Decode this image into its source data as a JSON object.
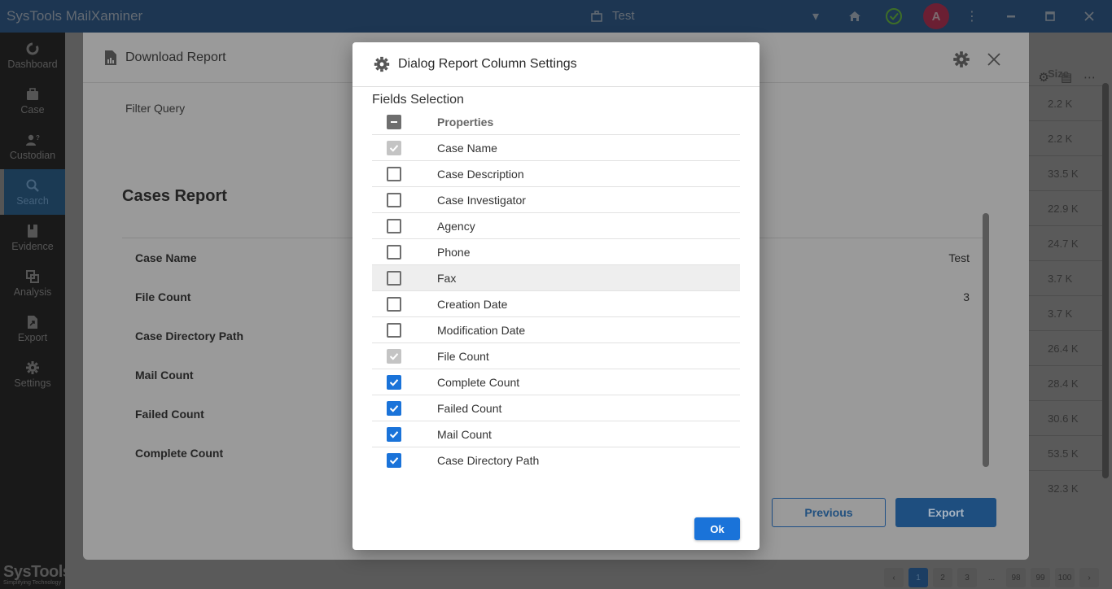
{
  "titlebar": {
    "app_title": "SysTools MailXaminer",
    "case_name": "Test",
    "avatar_letter": "A",
    "icons": [
      "briefcase-icon",
      "chevron-down-icon",
      "home-icon",
      "status-ok-icon",
      "more-vert-icon",
      "minimize-icon",
      "maximize-icon",
      "close-icon"
    ]
  },
  "sidebar": {
    "items": [
      {
        "label": "Dashboard",
        "icon": "dashboard-icon",
        "active": false
      },
      {
        "label": "Case",
        "icon": "briefcase-icon",
        "active": false
      },
      {
        "label": "Custodian",
        "icon": "custodian-icon",
        "active": false
      },
      {
        "label": "Search",
        "icon": "search-icon",
        "active": true
      },
      {
        "label": "Evidence",
        "icon": "evidence-icon",
        "active": false
      },
      {
        "label": "Analysis",
        "icon": "analysis-icon",
        "active": false
      },
      {
        "label": "Export",
        "icon": "export-icon",
        "active": false
      },
      {
        "label": "Settings",
        "icon": "gear-icon",
        "active": false
      }
    ],
    "brand": {
      "name": "SysTools",
      "tagline": "Simplifying Technology"
    }
  },
  "background_table": {
    "size_header": "Size",
    "sizes": [
      "2.2 K",
      "2.2 K",
      "33.5 K",
      "22.9 K",
      "24.7 K",
      "3.7 K",
      "3.7 K",
      "26.4 K",
      "28.4 K",
      "30.6 K",
      "53.5 K",
      "32.3 K"
    ],
    "pagination": {
      "prev": "‹",
      "pages": [
        "1",
        "2",
        "3",
        "...",
        "98",
        "99",
        "100"
      ],
      "current": "1",
      "next": "›"
    }
  },
  "download_report": {
    "title": "Download Report",
    "filter_query_label": "Filter Query",
    "report_title": "Cases Report",
    "rows": [
      {
        "key": "Case Name",
        "value": "Test"
      },
      {
        "key": "File Count",
        "value": "3"
      },
      {
        "key": "Case Directory Path",
        "value": ""
      },
      {
        "key": "Mail Count",
        "value": ""
      },
      {
        "key": "Failed Count",
        "value": ""
      },
      {
        "key": "Complete Count",
        "value": ""
      }
    ],
    "previous_label": "Previous",
    "export_label": "Export"
  },
  "column_settings": {
    "title": "Dialog Report Column Settings",
    "subtitle": "Fields Selection",
    "header_label": "Properties",
    "header_state": "indeterminate",
    "fields": [
      {
        "label": "Case Name",
        "state": "checked-disabled"
      },
      {
        "label": "Case Description",
        "state": "unchecked"
      },
      {
        "label": "Case Investigator",
        "state": "unchecked"
      },
      {
        "label": "Agency",
        "state": "unchecked"
      },
      {
        "label": "Phone",
        "state": "unchecked"
      },
      {
        "label": "Fax",
        "state": "unchecked",
        "hovered": true
      },
      {
        "label": "Creation Date",
        "state": "unchecked"
      },
      {
        "label": "Modification Date",
        "state": "unchecked"
      },
      {
        "label": "File Count",
        "state": "checked-disabled"
      },
      {
        "label": "Complete Count",
        "state": "checked"
      },
      {
        "label": "Failed Count",
        "state": "checked"
      },
      {
        "label": "Mail Count",
        "state": "checked"
      },
      {
        "label": "Case Directory Path",
        "state": "checked"
      }
    ],
    "ok_label": "Ok",
    "accent_color": "#1a73d9"
  }
}
